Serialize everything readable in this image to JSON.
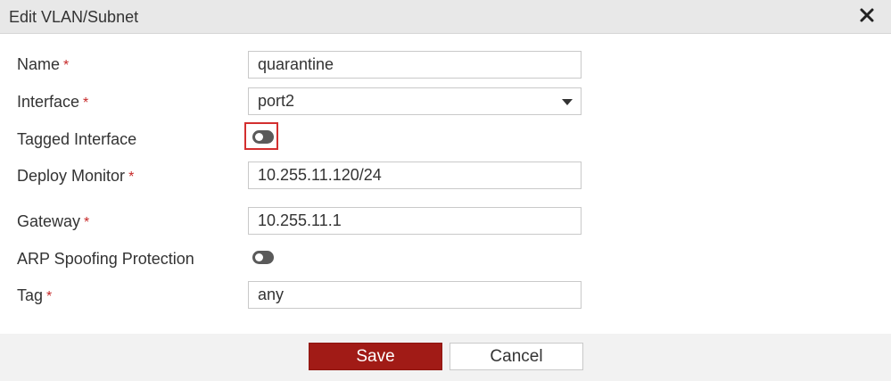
{
  "dialog": {
    "title": "Edit VLAN/Subnet",
    "close_icon": "close-icon"
  },
  "form": {
    "required_marker": "*",
    "name": {
      "label": "Name",
      "value": "quarantine",
      "required": true
    },
    "interface": {
      "label": "Interface",
      "value": "port2",
      "required": true
    },
    "tagged_interface": {
      "label": "Tagged Interface",
      "enabled": false
    },
    "deploy_monitor": {
      "label": "Deploy Monitor",
      "value": "10.255.11.120/24",
      "required": true
    },
    "gateway": {
      "label": "Gateway",
      "value": "10.255.11.1",
      "required": true
    },
    "arp_spoofing": {
      "label": "ARP Spoofing Protection",
      "enabled": false
    },
    "tag": {
      "label": "Tag",
      "value": "any",
      "required": true
    }
  },
  "footer": {
    "save_label": "Save",
    "cancel_label": "Cancel"
  },
  "colors": {
    "save_button": "#a11b16",
    "required_marker": "#c62828",
    "highlight": "#d32f2f",
    "toggle_off": "#5a5a5a"
  }
}
